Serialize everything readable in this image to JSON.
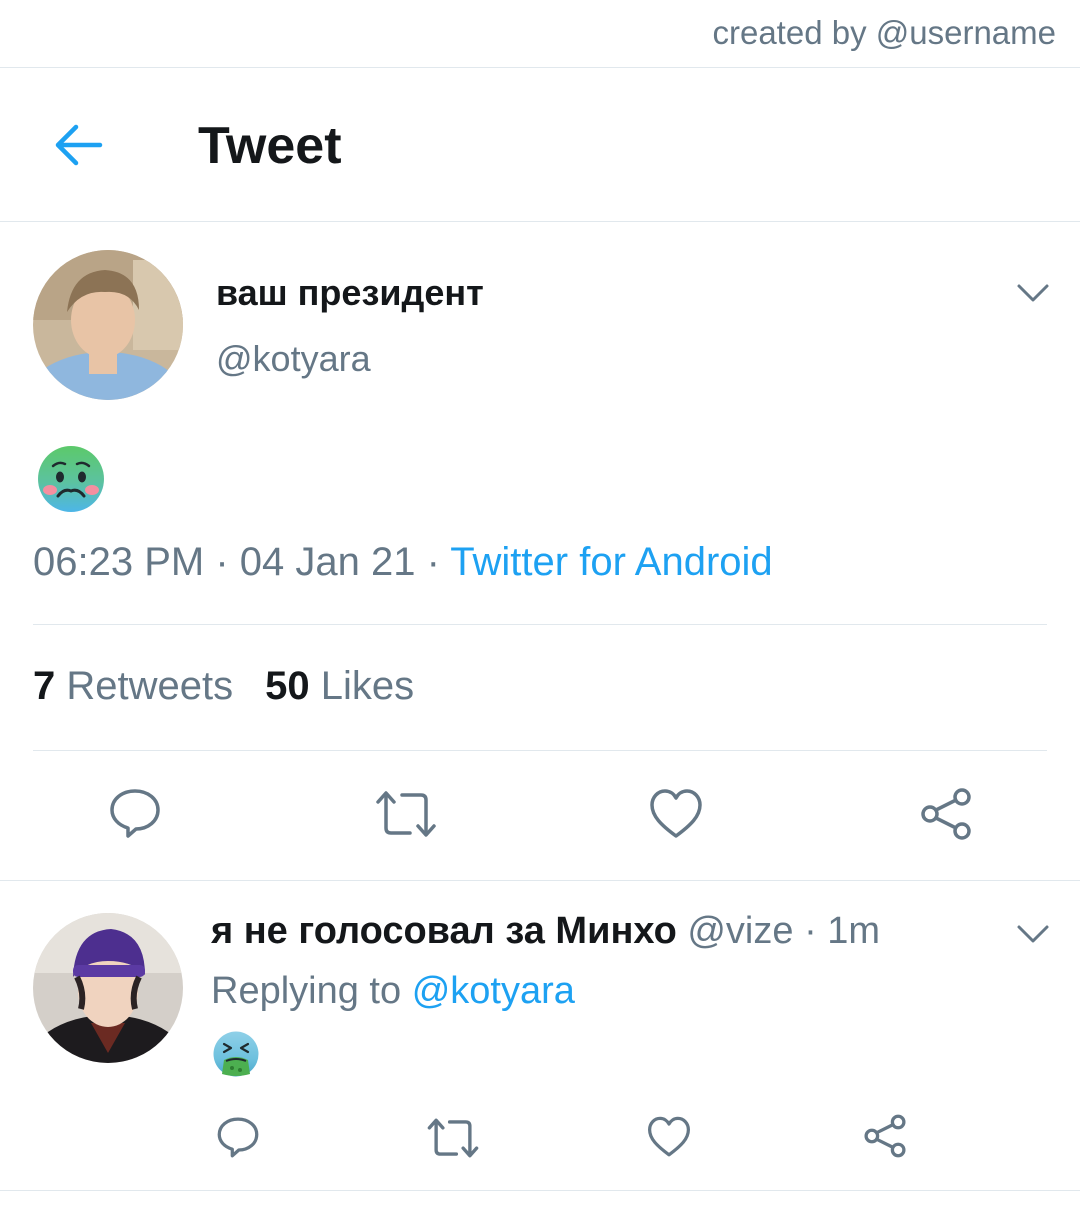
{
  "credit": "created by @username",
  "header": {
    "title": "Tweet"
  },
  "tweet": {
    "display_name": "ваш президент",
    "handle": "@kotyara",
    "content_emoji": "nauseated-face-icon",
    "time": "06:23 PM",
    "date": "04 Jan 21",
    "source": "Twitter for Android",
    "separator": " · ",
    "retweet_count": "7",
    "retweet_label": "Retweets",
    "like_count": "50",
    "like_label": "Likes"
  },
  "reply": {
    "display_name": "я не голосовал за Минхо",
    "handle": "@vize",
    "age": "1m",
    "replying_prefix": "Replying to",
    "replying_to": "@kotyara",
    "content_emoji": "vomiting-face-icon"
  },
  "colors": {
    "accent": "#1da1f2",
    "text": "#14171a",
    "secondary": "#657786",
    "border": "#e1e8ed",
    "icon": "#657786"
  },
  "icons": [
    "back-arrow-icon",
    "chevron-down-icon",
    "reply-icon",
    "retweet-icon",
    "like-icon",
    "share-icon"
  ]
}
